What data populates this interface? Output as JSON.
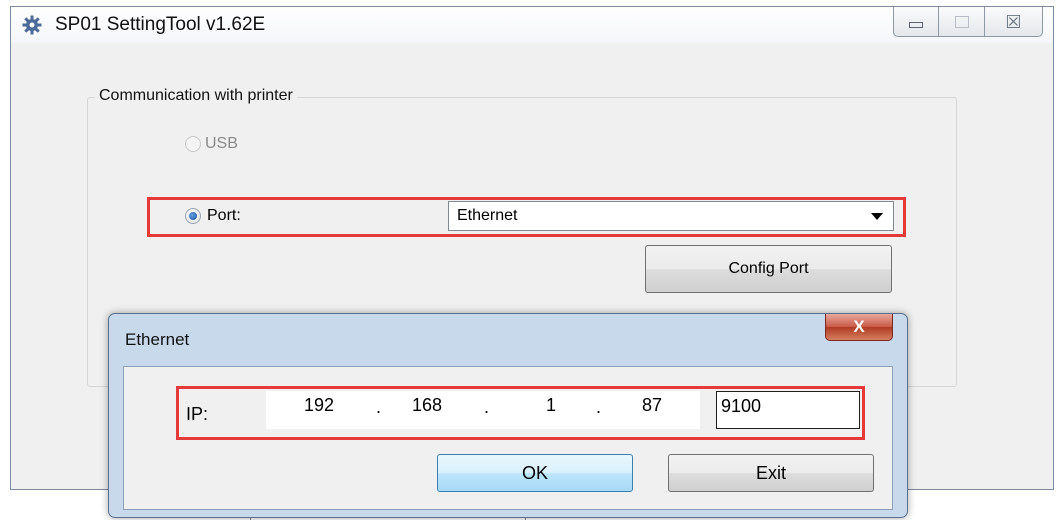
{
  "window": {
    "title": "SP01 SettingTool v1.62E",
    "controls": {
      "close_glyph": "☒"
    }
  },
  "group": {
    "label": "Communication with printer",
    "usb_label": "USB",
    "usb_enabled": false,
    "port_label": "Port:",
    "port_selected": true,
    "port_value": "Ethernet",
    "config_button": "Config Port"
  },
  "dialog": {
    "title": "Ethernet",
    "close_glyph": "X",
    "ip_label": "IP:",
    "ip_octets": [
      "192",
      "168",
      "1",
      "87"
    ],
    "port_number": "9100",
    "ok_button": "OK",
    "exit_button": "Exit"
  },
  "colors": {
    "highlight": "#e5393a",
    "dialog_frame": "#c9d9ec",
    "window_bg": "#f0f0f0"
  }
}
